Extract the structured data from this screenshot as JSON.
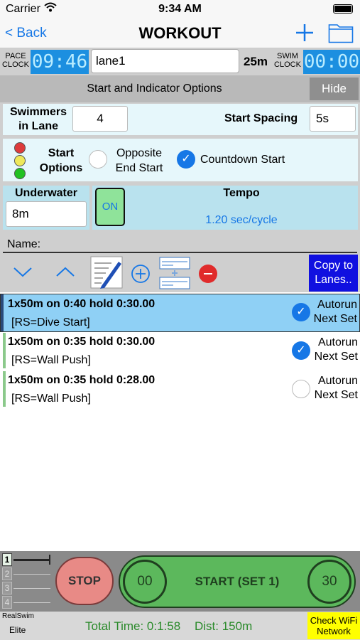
{
  "status_bar": {
    "carrier": "Carrier",
    "time": "9:34 AM"
  },
  "nav": {
    "back_label": "< Back",
    "title": "WORKOUT"
  },
  "clocks": {
    "pace_label": "PACE CLOCK",
    "pace_value": "09:46",
    "lane_value": "lane1",
    "distance": "25m",
    "swim_label": "SWIM CLOCK",
    "swim_value": "00:00"
  },
  "start_options": {
    "header": "Start and Indicator Options",
    "hide_label": "Hide",
    "swimmers_label": "Swimmers in Lane",
    "swimmers_value": "4",
    "spacing_label": "Start Spacing",
    "spacing_value": "5s",
    "start_options_label": "Start Options",
    "opposite_end_label": "Opposite End Start",
    "countdown_label": "Countdown Start",
    "underwater_label": "Underwater",
    "underwater_value": "8m",
    "on_label": "ON",
    "tempo_label": "Tempo",
    "tempo_value": "1.20 sec/cycle"
  },
  "name_label": "Name:",
  "toolbar": {
    "copy_label": "Copy to Lanes.."
  },
  "sets": [
    {
      "title": "1x50m on 0:40 hold 0:30.00",
      "sub": "[RS=Dive Start]",
      "autorun": "Autorun Next Set",
      "checked": true,
      "selected": true
    },
    {
      "title": "1x50m on 0:35 hold 0:30.00",
      "sub": "[RS=Wall Push]",
      "autorun": "Autorun Next Set",
      "checked": true,
      "selected": false
    },
    {
      "title": "1x50m on 0:35 hold 0:28.00",
      "sub": "[RS=Wall Push]",
      "autorun": "Autorun Next Set",
      "checked": false,
      "selected": false
    }
  ],
  "controls": {
    "lanes": [
      "1",
      "2",
      "3",
      "4"
    ],
    "stop_label": "STOP",
    "left_count": "00",
    "start_label": "START (SET 1)",
    "right_count": "30"
  },
  "footer": {
    "brand_top": "RealSwim",
    "brand_bottom": "Elite",
    "total_time": "Total Time: 0:1:58",
    "dist": "Dist: 150m",
    "wifi_label": "Check WiFi Network"
  },
  "colors": {
    "accent": "#1677e6",
    "clock_bg": "#1c8fe0",
    "selected_row": "#8fd0f5",
    "start_green": "#5cb85c",
    "stop_red": "#e88a86",
    "wifi_yellow": "#ffff00"
  }
}
